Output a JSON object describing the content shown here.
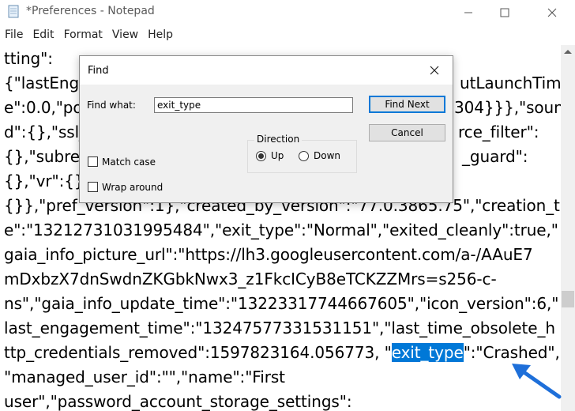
{
  "window": {
    "title": "*Preferences - Notepad",
    "minimize_icon": "minimize-icon",
    "maximize_icon": "maximize-icon",
    "close_icon": "close-icon"
  },
  "menu": [
    "File",
    "Edit",
    "Format",
    "View",
    "Help"
  ],
  "editor": {
    "lines": [
      "tting\":",
      "{\"lastEnga",
      "e\":0.0,\"po",
      "d\":{},\"ssl_",
      "{},\"subres",
      "{},\"vr\":{},\"v",
      "{}},\"pref_version\":1},\"created_by_version\":\"77.0.3865.75\",\"creation_tim",
      "e\":\"13212731031995484\",\"exit_type\":\"Normal\",\"exited_cleanly\":true,\"",
      "gaia_info_picture_url\":\"https://lh3.googleusercontent.com/a-/AAuE7",
      "mDxbzX7dnSwdnZKGbkNwx3_z1FkcICyB8eTCKZZMrs=s256-c-",
      "ns\",\"gaia_info_update_time\":\"13223317744667605\",\"icon_version\":6,\"",
      "last_engagement_time\":\"13247577331531151\",\"last_time_obsolete_h",
      "ttp_credentials_removed\":1597823164.056773, \"",
      "\"managed_user_id\":\"\",\"name\":\"First",
      "user\",\"password_account_storage_settings\":"
    ],
    "right_fragments": {
      "line2": "utLaunchTim",
      "line3": "304}}},\"soun",
      "line4": "rce_filter\":",
      "line5": "_guard\":"
    },
    "selected_text": "exit_type",
    "after_selection": "\":\"Crashed\","
  },
  "find_dialog": {
    "title": "Find",
    "find_what_label": "Find what:",
    "find_what_value": "exit_type",
    "find_next_label": "Find Next",
    "cancel_label": "Cancel",
    "direction_label": "Direction",
    "up_label": "Up",
    "down_label": "Down",
    "direction_selected": "Up",
    "match_case_label": "Match case",
    "match_case_checked": false,
    "wrap_around_label": "Wrap around",
    "wrap_around_checked": false
  },
  "colors": {
    "selection": "#0078d7",
    "arrow": "#1e6fd9"
  }
}
